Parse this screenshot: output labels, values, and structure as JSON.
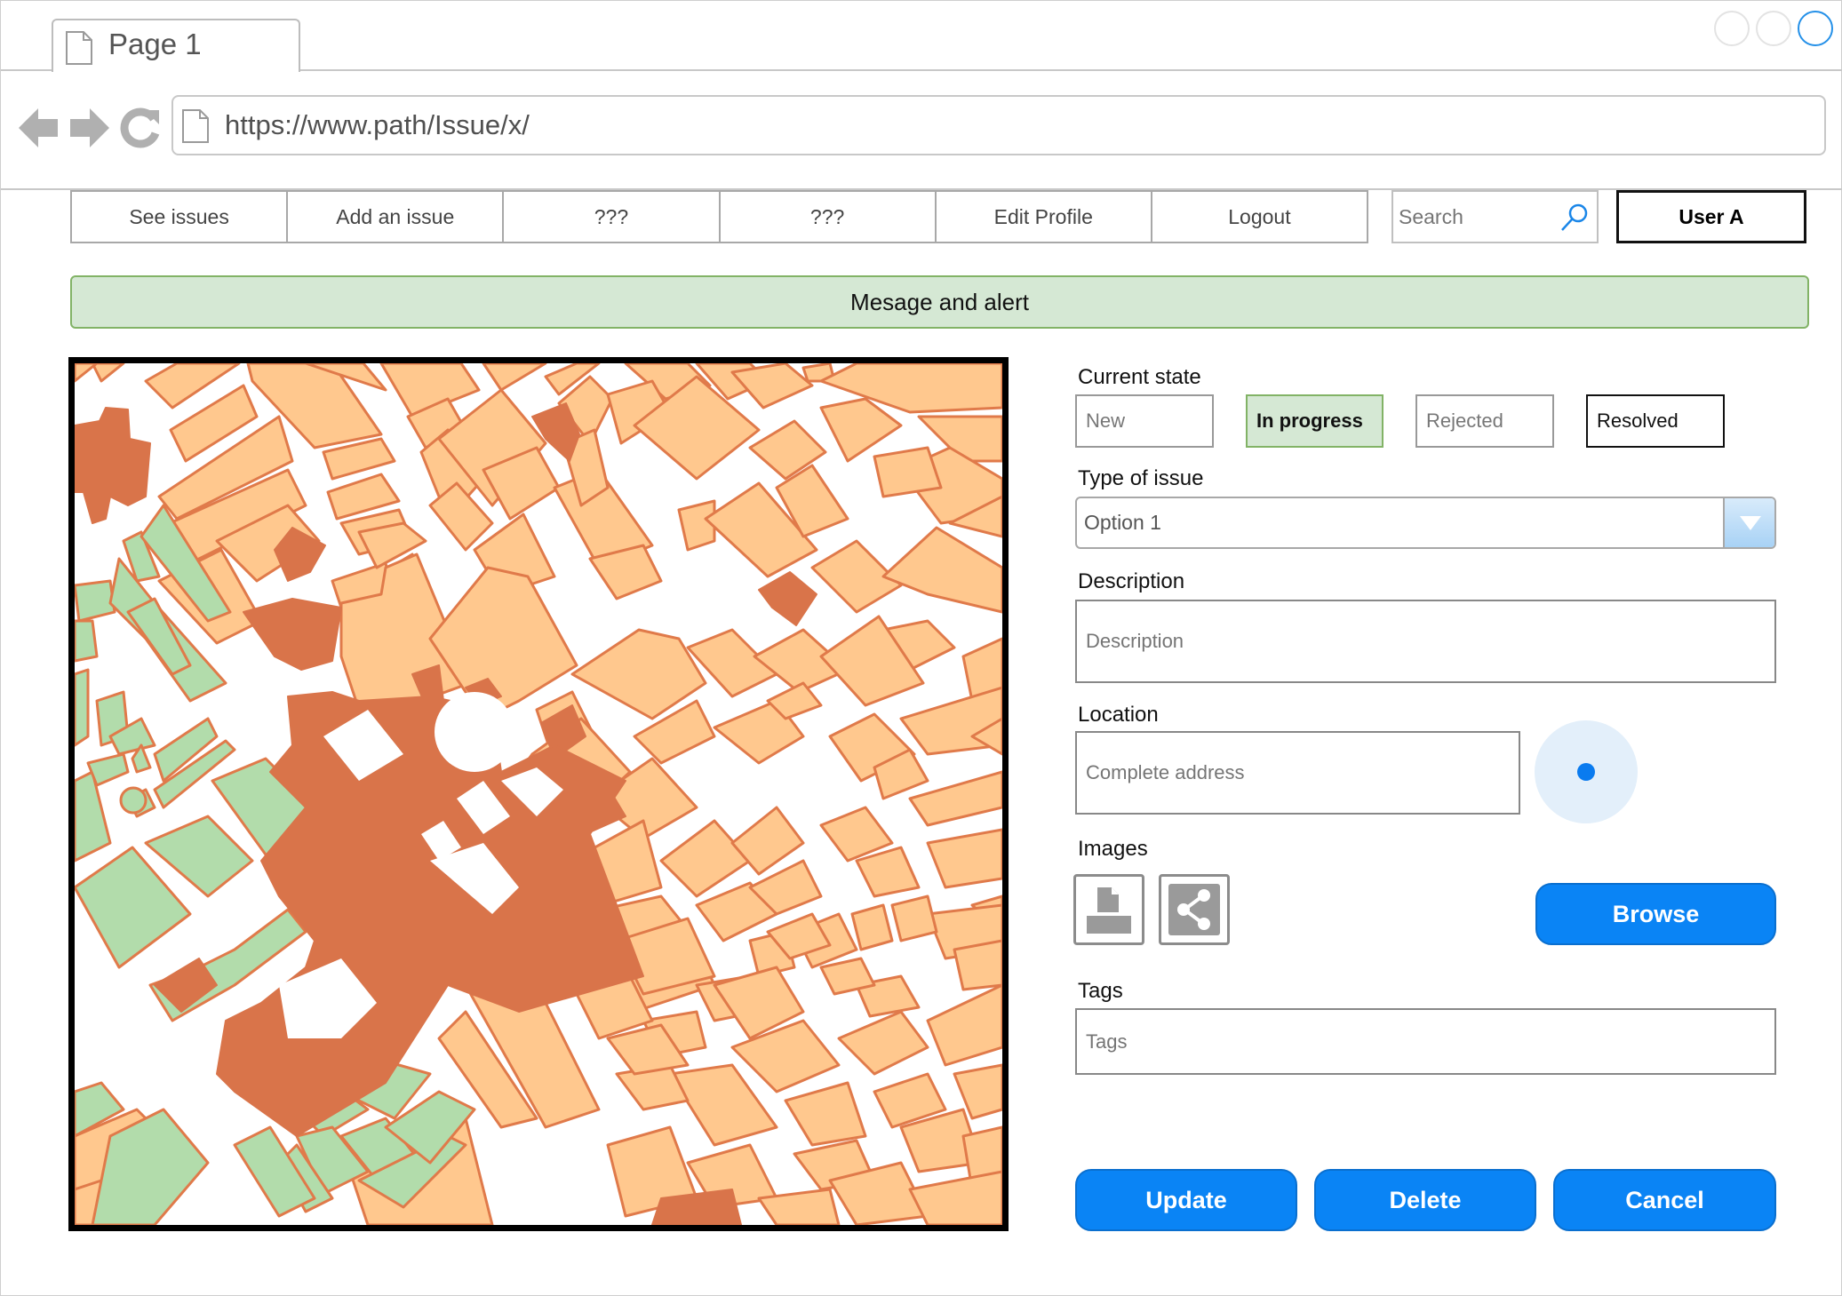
{
  "browser": {
    "tab_label": "Page 1",
    "url": "https://www.path/Issue/x/"
  },
  "menu": {
    "items": [
      "See issues",
      "Add an issue",
      "???",
      "???",
      "Edit Profile",
      "Logout"
    ],
    "search_placeholder": "Search",
    "user": "User A"
  },
  "alert": "Mesage and alert",
  "form": {
    "current_state_label": "Current state",
    "states": [
      "New",
      "In progress",
      "Rejected",
      "Resolved"
    ],
    "selected_state": "In progress",
    "type_label": "Type of issue",
    "type_value": "Option 1",
    "description_label": "Description",
    "description_placeholder": "Description",
    "location_label": "Location",
    "location_placeholder": "Complete address",
    "images_label": "Images",
    "browse": "Browse",
    "tags_label": "Tags",
    "tags_placeholder": "Tags",
    "update": "Update",
    "delete": "Delete",
    "cancel": "Cancel"
  },
  "colors": {
    "accent_blue": "#0a84f5",
    "alert_bg": "#d5e8d4",
    "alert_border": "#82b366",
    "map_building": "#ffc88e",
    "map_building_edge": "#e07a4a",
    "map_landmark": "#d9744a",
    "map_park": "#b2dcab"
  }
}
